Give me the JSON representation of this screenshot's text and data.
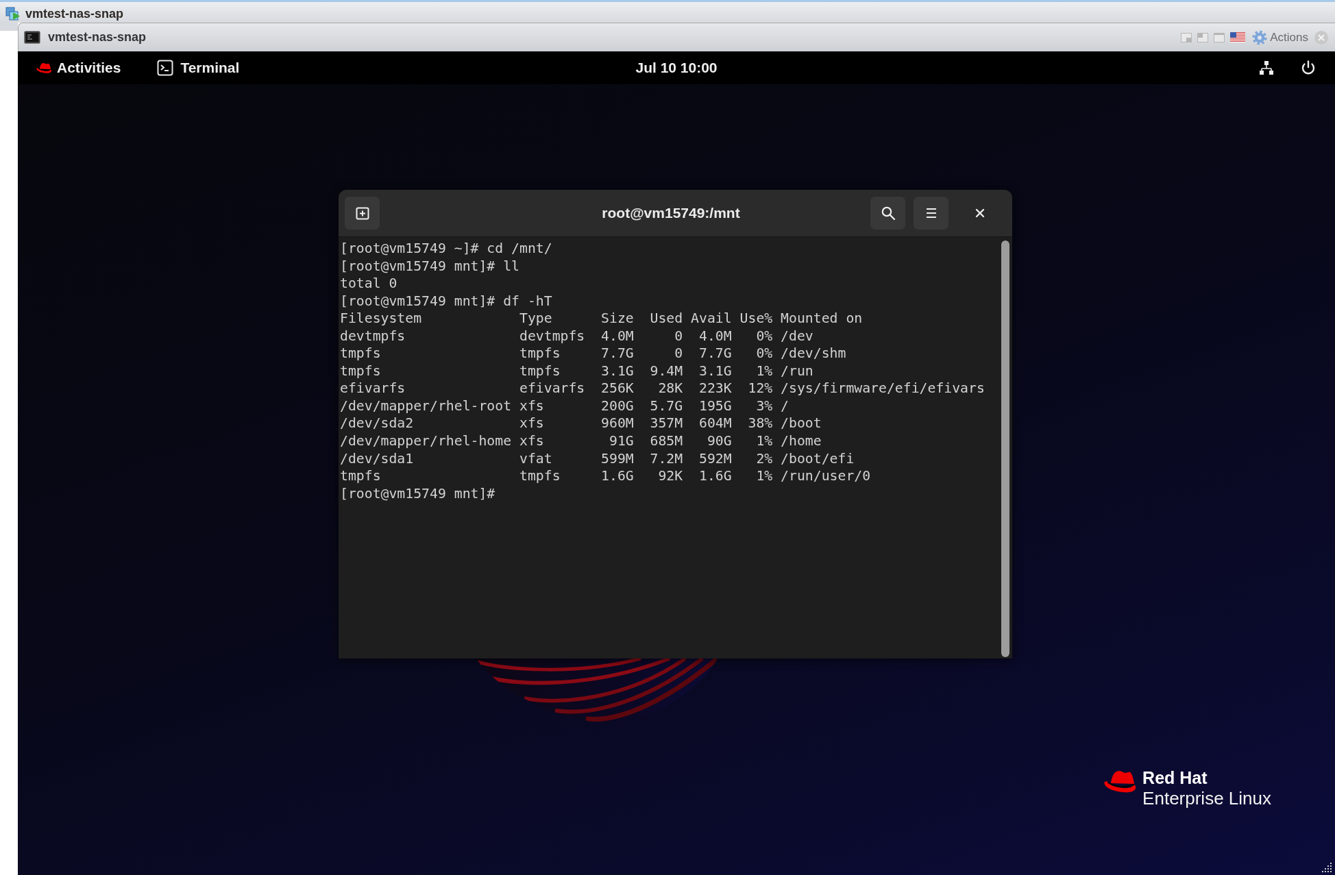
{
  "host_window": {
    "title": "vmtest-nas-snap"
  },
  "console_window": {
    "title": "vmtest-nas-snap",
    "actions_label": "Actions"
  },
  "top_bar": {
    "activities": "Activities",
    "app_menu": "Terminal",
    "clock": "Jul 10 10:00"
  },
  "terminal": {
    "title": "root@vm15749:/mnt",
    "lines": [
      "[root@vm15749 ~]# cd /mnt/",
      "[root@vm15749 mnt]# ll",
      "total 0",
      "[root@vm15749 mnt]# df -hT",
      "Filesystem            Type      Size  Used Avail Use% Mounted on",
      "devtmpfs              devtmpfs  4.0M     0  4.0M   0% /dev",
      "tmpfs                 tmpfs     7.7G     0  7.7G   0% /dev/shm",
      "tmpfs                 tmpfs     3.1G  9.4M  3.1G   1% /run",
      "efivarfs              efivarfs  256K   28K  223K  12% /sys/firmware/efi/efivars",
      "/dev/mapper/rhel-root xfs       200G  5.7G  195G   3% /",
      "/dev/sda2             xfs       960M  357M  604M  38% /boot",
      "/dev/mapper/rhel-home xfs        91G  685M   90G   1% /home",
      "/dev/sda1             vfat      599M  7.2M  592M   2% /boot/efi",
      "tmpfs                 tmpfs     1.6G   92K  1.6G   1% /run/user/0",
      "[root@vm15749 mnt]#"
    ]
  },
  "wallpaper_logo": {
    "title": "Red Hat",
    "subtitle": "Enterprise Linux"
  }
}
